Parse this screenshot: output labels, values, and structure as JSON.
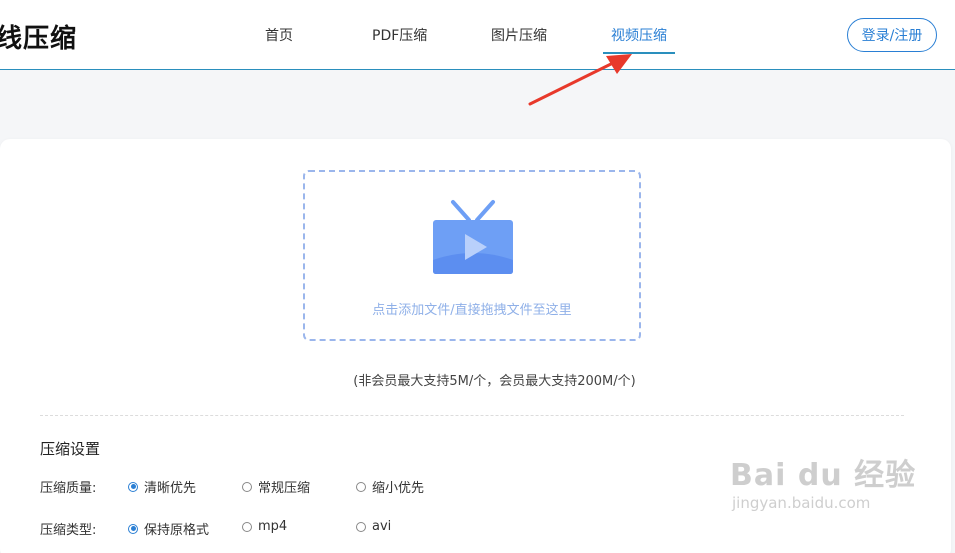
{
  "header": {
    "logo": "线压缩",
    "nav": [
      "首页",
      "PDF压缩",
      "图片压缩",
      "视频压缩"
    ],
    "active_index": 3,
    "login_label": "登录/注册"
  },
  "upload": {
    "hint": "点击添加文件/直接拖拽文件至这里",
    "limit": "(非会员最大支持5M/个，会员最大支持200M/个)"
  },
  "settings": {
    "title": "压缩设置",
    "quality": {
      "label": "压缩质量:",
      "options": [
        "清晰优先",
        "常规压缩",
        "缩小优先"
      ],
      "selected": 0
    },
    "type": {
      "label": "压缩类型:",
      "options": [
        "保持原格式",
        "mp4",
        "avi"
      ],
      "selected": 0
    }
  },
  "watermark": {
    "main": "Bai du 经验",
    "sub": "jingyan.baidu.com"
  },
  "colors": {
    "accent": "#2a7fd4",
    "nav_line": "#2a8fbd",
    "tv_icon": "#6e9ff5",
    "annotation_arrow": "#e8392b"
  }
}
